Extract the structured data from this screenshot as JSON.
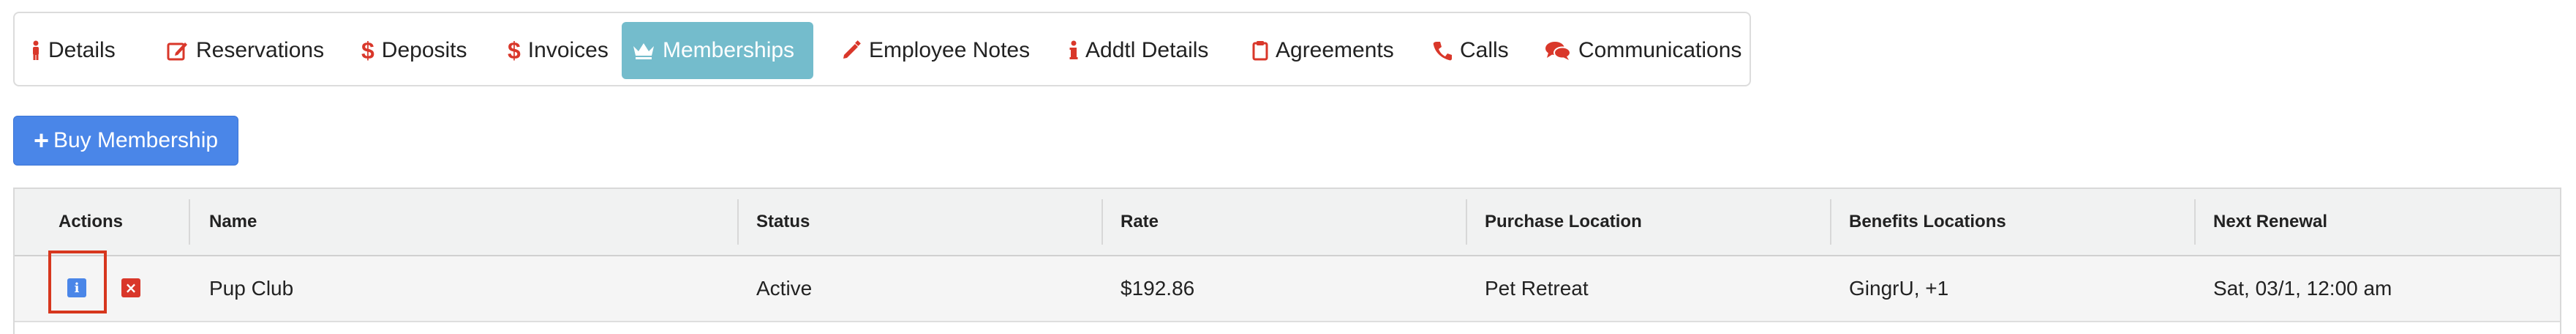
{
  "tabs": [
    {
      "label": "Details",
      "icon": "person-icon"
    },
    {
      "label": "Reservations",
      "icon": "edit-square-icon"
    },
    {
      "label": "Deposits",
      "icon": "dollar-icon"
    },
    {
      "label": "Invoices",
      "icon": "dollar-icon"
    },
    {
      "label": "Memberships",
      "icon": "crown-icon",
      "active": true
    },
    {
      "label": "Employee Notes",
      "icon": "pencil-icon"
    },
    {
      "label": "Addtl Details",
      "icon": "info-icon"
    },
    {
      "label": "Agreements",
      "icon": "clipboard-icon"
    },
    {
      "label": "Calls",
      "icon": "phone-icon"
    },
    {
      "label": "Communications",
      "icon": "comments-icon"
    }
  ],
  "buy_button": {
    "label": "Buy Membership",
    "icon": "plus-icon"
  },
  "table": {
    "headers": [
      "Actions",
      "Name",
      "Status",
      "Rate",
      "Purchase Location",
      "Benefits Locations",
      "Next Renewal"
    ],
    "rows": [
      {
        "name": "Pup Club",
        "status": "Active",
        "rate": "$192.86",
        "purchase_location": "Pet Retreat",
        "benefits_locations": "GingrU, +1",
        "next_renewal": "Sat, 03/1, 12:00 am"
      }
    ]
  },
  "colors": {
    "accent_blue": "#4a86e8",
    "active_tab": "#74bccc",
    "icon_red": "#d9372a",
    "highlight_red": "#d7371e"
  }
}
